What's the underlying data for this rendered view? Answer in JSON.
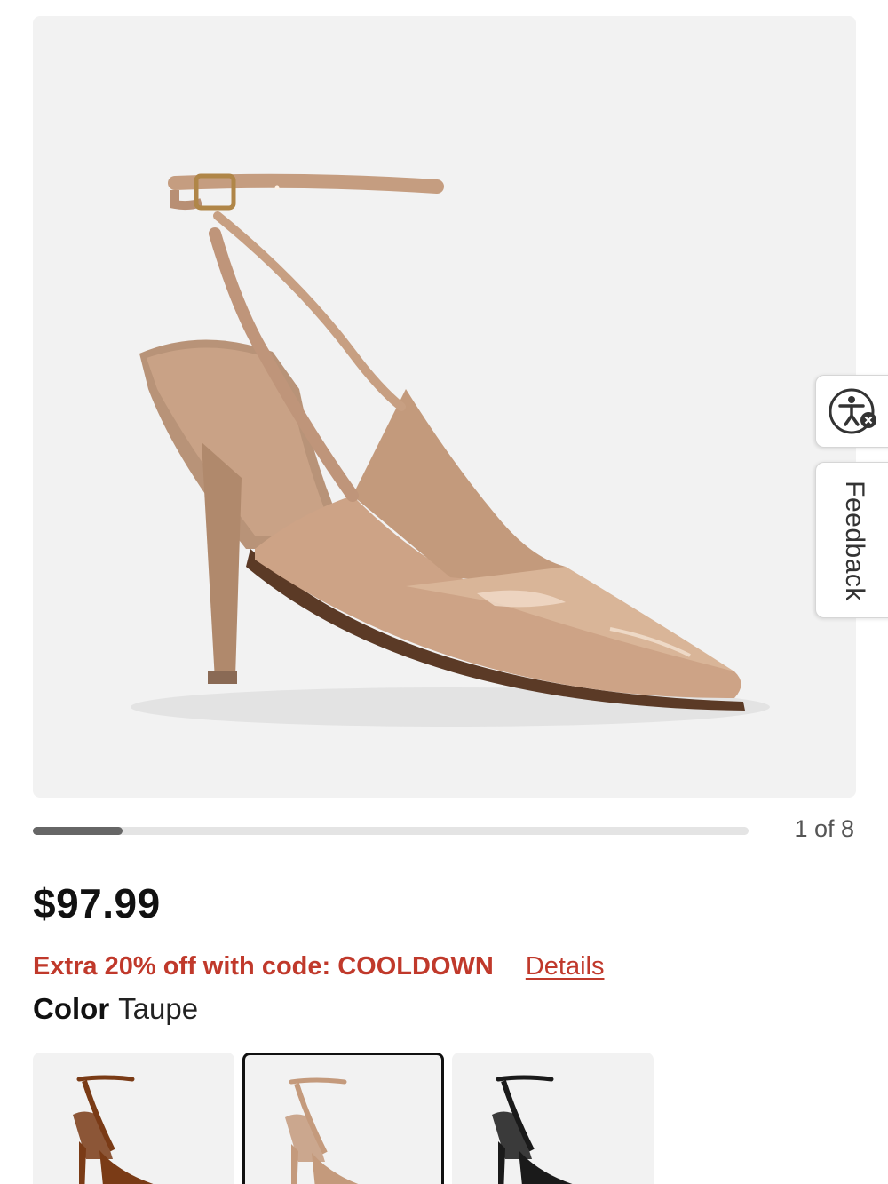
{
  "gallery": {
    "counter": "1 of 8",
    "current_index": 1,
    "total": 8,
    "progress_fraction": 0.125
  },
  "product": {
    "price": "$97.99",
    "promo_text": "Extra 20% off with code: COOLDOWN",
    "details_link": "Details",
    "color_label": "Color",
    "color_value": "Taupe",
    "promo_color": "#c0392b"
  },
  "swatches": [
    {
      "color": "#7a3b16",
      "selected": false
    },
    {
      "color": "#c49a7c",
      "selected": true
    },
    {
      "color": "#1a1a1a",
      "selected": false
    }
  ],
  "side_widgets": {
    "accessibility_icon": "accessibility-icon",
    "feedback_label": "Feedback"
  }
}
